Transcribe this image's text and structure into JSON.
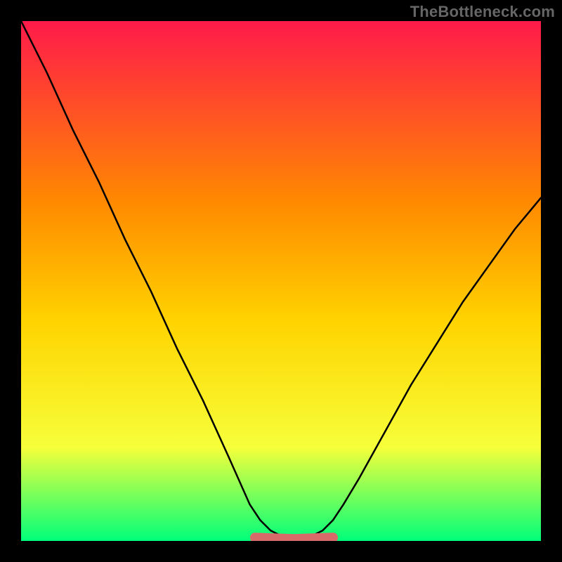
{
  "watermark": {
    "text": "TheBottleneck.com"
  },
  "colors": {
    "frame_background": "#000000",
    "gradient_top": "#ff1a4a",
    "gradient_mid_upper": "#ff8a00",
    "gradient_mid": "#ffd400",
    "gradient_mid_lower": "#f6ff3a",
    "gradient_bottom": "#00ff7a",
    "curve_stroke": "#000000",
    "marker_fill": "#d86a6a",
    "marker_stroke": "#b24e4e"
  },
  "chart_data": {
    "type": "line",
    "title": "",
    "xlabel": "",
    "ylabel": "",
    "xlim": [
      0,
      100
    ],
    "ylim": [
      0,
      100
    ],
    "grid": false,
    "legend": false,
    "series": [
      {
        "name": "bottleneck_curve",
        "x": [
          0,
          5,
          10,
          15,
          20,
          25,
          30,
          35,
          40,
          44,
          46,
          48,
          50,
          52,
          54,
          56,
          58,
          60,
          62,
          65,
          70,
          75,
          80,
          85,
          90,
          95,
          100
        ],
        "y": [
          100,
          90,
          79,
          69,
          58,
          48,
          37,
          27,
          16,
          7,
          4,
          2,
          1,
          0.5,
          0.5,
          1,
          2,
          4,
          7,
          12,
          21,
          30,
          38,
          46,
          53,
          60,
          66
        ]
      }
    ],
    "optimal_band": {
      "x_start": 45,
      "x_end": 60,
      "y": 0.5
    }
  }
}
